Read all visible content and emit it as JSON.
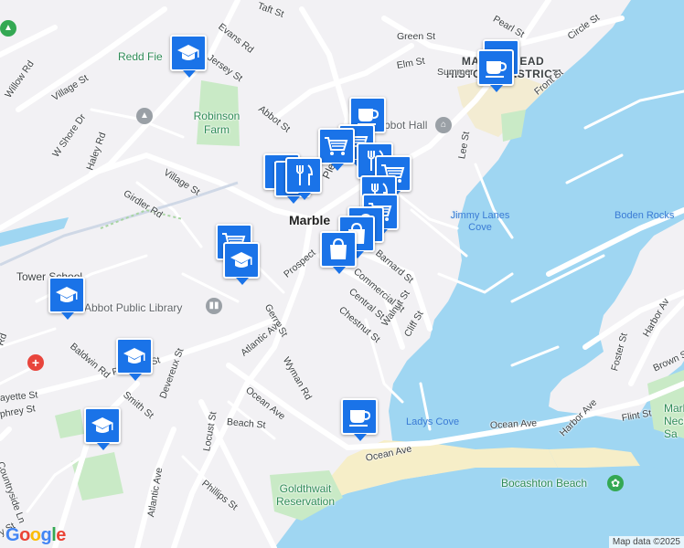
{
  "map": {
    "place_name": "Marblehead",
    "district_label": "MARBLEHEAD HISTORIC DISTRICT",
    "attribution": "Map data ©2025",
    "logo": "Google",
    "colors": {
      "water": "#9fd6f2",
      "land": "#f2f1f4",
      "park": "#c9eac6",
      "road": "#ffffff",
      "marker": "#1a73e8",
      "hospital": "#e8453c",
      "poi_grey": "#9aa0a6",
      "park_poi": "#34a853"
    }
  },
  "labels": {
    "evans_rd": "Evans Rd",
    "taft_st": "Taft St",
    "pearl_st": "Pearl St",
    "circle_st": "Circle St",
    "green_st": "Green St",
    "redd_field": "Redd Fie",
    "jersey_st": "Jersey St",
    "elm_st": "Elm St",
    "willow_rd": "Willow Rd",
    "village_st_top": "Village St",
    "w_shore_dr": "W Shore Dr",
    "robinson_farm": "Robinson Farm",
    "abbot_st": "Abbot St",
    "abbot_hall": "Abbot Hall",
    "summer_st": "Summer",
    "front_st": "Front St",
    "haley_rd": "Haley Rd",
    "village_st": "Village St",
    "girdler_rd": "Girdler Rd",
    "pleasant_st_top": "Pleasa",
    "lee_st": "Lee St",
    "jimmy_lanes_cove": "Jimmy Lanes Cove",
    "boden_rocks": "Boden Rocks",
    "marble": "Marble",
    "tower_school": "Tower School",
    "prospect": "Prospect",
    "barnard_st": "Barnard St",
    "commercial_st": "Commercial St",
    "central_st": "Central St",
    "chestnut_st": "Chestnut St",
    "walnut_st": "Walnut St",
    "cliff_st": "Cliff St",
    "gerry_st": "Gerry St",
    "abbot_public_library": "Abbot Public Library",
    "baldwin_rd": "Baldwin Rd",
    "atlantic_ave": "Atlantic Ave",
    "wyman_rd": "Wyman Rd",
    "pleasant_st": "Pleasant St",
    "smith_st": "Smith St",
    "devereux_st": "Devereux St",
    "fayette_st": "ayette St",
    "humphrey_st": "phrey St",
    "ocean_ave": "Ocean Ave",
    "beach_st": "Beach St",
    "ladys_cove": "Ladys Cove",
    "harbor_ave": "Harbor Ave",
    "foster_st": "Foster St",
    "brown_st": "Brown St",
    "harbor_ave_right": "Harbor Av",
    "marblehead_neck": "Marb Neck Sa",
    "flint_st": "Flint St",
    "ocean_ave_mid": "Ocean Ave",
    "ocean_ave_low": "Ocean Ave",
    "bocashton_beach": "Bocashton Beach",
    "countryside_ln": "Countryside Ln",
    "locust_st": "Locust St",
    "phillips_st": "Phillips St",
    "atlantic_ave_low": "Atlantic Ave",
    "goldthwait": "Goldthwait Reservation",
    "ford_rd": "Rd",
    "y_st": "y St"
  },
  "markers": [
    {
      "id": "school-redd",
      "icon": "graduation-cap-icon"
    },
    {
      "id": "cafe-district-1",
      "icon": "coffee-cup-icon"
    },
    {
      "id": "cafe-district-2",
      "icon": "coffee-cup-icon"
    },
    {
      "id": "cafe-abbot-hall",
      "icon": "coffee-cup-icon"
    },
    {
      "id": "grocery-pleasant-1",
      "icon": "shopping-cart-icon"
    },
    {
      "id": "grocery-pleasant-2",
      "icon": "shopping-cart-icon"
    },
    {
      "id": "restaurant-washington",
      "icon": "fork-knife-icon"
    },
    {
      "id": "grocery-washington",
      "icon": "shopping-cart-icon"
    },
    {
      "id": "restaurant-center-1",
      "icon": "fork-knife-icon"
    },
    {
      "id": "restaurant-center-2",
      "icon": "fork-knife-icon"
    },
    {
      "id": "restaurant-center-3",
      "icon": "fork-knife-icon"
    },
    {
      "id": "restaurant-center-4",
      "icon": "fork-knife-icon"
    },
    {
      "id": "grocery-center",
      "icon": "shopping-cart-icon"
    },
    {
      "id": "shop-center-1",
      "icon": "shopping-bag-icon"
    },
    {
      "id": "shop-center-2",
      "icon": "shopping-bag-icon"
    },
    {
      "id": "shop-center-3",
      "icon": "shopping-bag-icon"
    },
    {
      "id": "grocery-prospect",
      "icon": "shopping-cart-icon"
    },
    {
      "id": "school-prospect",
      "icon": "graduation-cap-icon"
    },
    {
      "id": "school-tower",
      "icon": "graduation-cap-icon"
    },
    {
      "id": "school-pleasant",
      "icon": "graduation-cap-icon"
    },
    {
      "id": "school-humphrey",
      "icon": "graduation-cap-icon"
    },
    {
      "id": "cafe-ocean-ave",
      "icon": "coffee-cup-icon"
    }
  ]
}
